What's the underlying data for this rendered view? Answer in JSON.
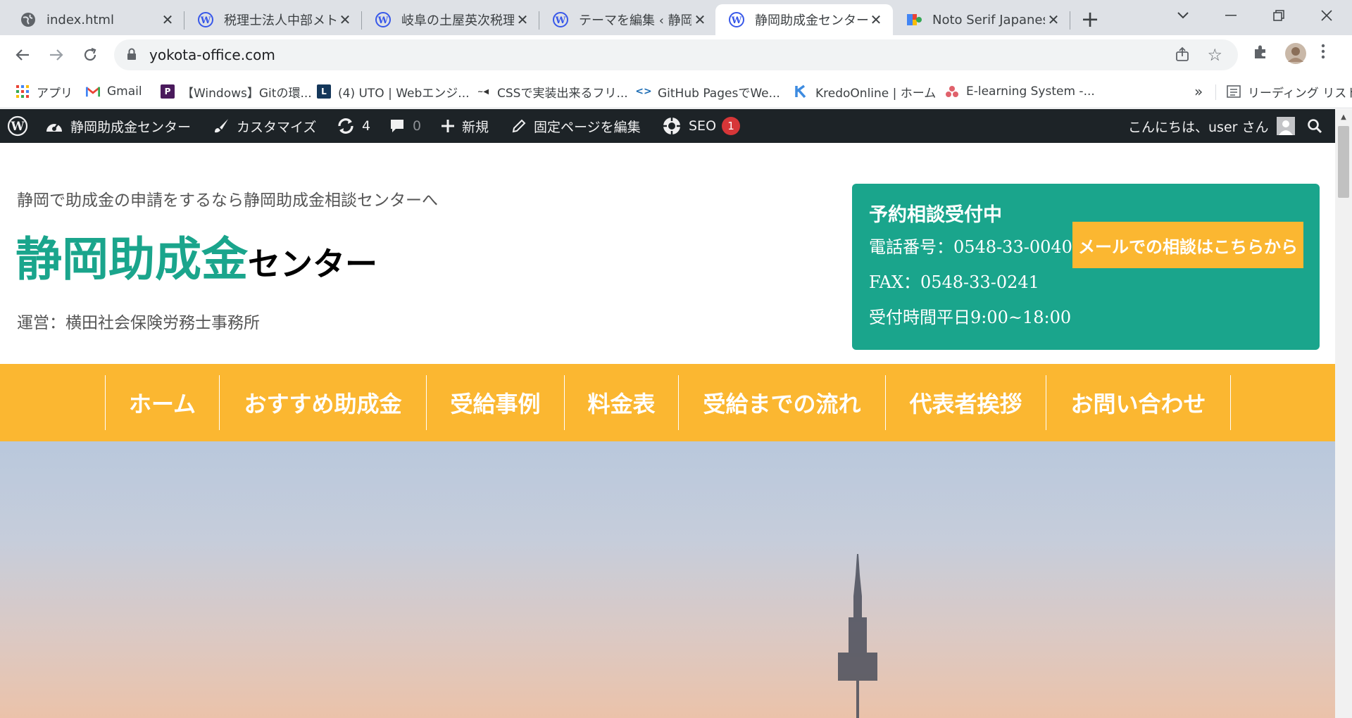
{
  "browser": {
    "tabs": [
      {
        "title": "index.html",
        "icon": "globe-icon"
      },
      {
        "title": "税理士法人中部メト",
        "icon": "wordpress-icon"
      },
      {
        "title": "岐阜の土屋英次税理",
        "icon": "wordpress-icon"
      },
      {
        "title": "テーマを編集 ‹ 静岡助",
        "icon": "wordpress-icon"
      },
      {
        "title": "静岡助成金センター",
        "icon": "wordpress-icon"
      },
      {
        "title": "Noto Serif Japanese",
        "icon": "google-fonts-icon"
      }
    ],
    "active_tab": 4,
    "url": "yokota-office.com"
  },
  "bookmarks": [
    {
      "label": "アプリ",
      "icon": "apps-grid-icon"
    },
    {
      "label": "Gmail",
      "icon": "gmail-icon"
    },
    {
      "label": "【Windows】Gitの環...",
      "icon": "bookmark-p-icon"
    },
    {
      "label": "(4) UTO | Webエンジ...",
      "icon": "bookmark-l-icon"
    },
    {
      "label": "CSSで実装出来るフリ...",
      "icon": "bookmark-css-icon"
    },
    {
      "label": "GitHub PagesでWe...",
      "icon": "code-icon"
    },
    {
      "label": "KredoOnline | ホーム",
      "icon": "kredo-icon"
    },
    {
      "label": "E-learning System -...",
      "icon": "elearning-icon"
    }
  ],
  "bookmarks_overflow": "»",
  "reading_list": "リーディング リスト",
  "admin_bar": {
    "site_name": "静岡助成金センター",
    "customize": "カスタマイズ",
    "updates": "4",
    "comments": "0",
    "new": "新規",
    "edit_page": "固定ページを編集",
    "seo": "SEO",
    "seo_badge": "1",
    "greeting": "こんにちは、user さん"
  },
  "header": {
    "tagline": "静岡で助成金の申請をするなら静岡助成金相談センターへ",
    "title_main": "静岡助成金",
    "title_suffix": "センター",
    "operator": "運営：横田社会保険労務士事務所"
  },
  "contact": {
    "heading": "予約相談受付中",
    "phone": "電話番号：0548-33-0040",
    "fax": "FAX：0548-33-0241",
    "hours": "受付時間平日9:00~18:00",
    "mail_button": "メールでの相談はこちらから"
  },
  "nav": [
    "ホーム",
    "おすすめ助成金",
    "受給事例",
    "料金表",
    "受給までの流れ",
    "代表者挨拶",
    "お問い合わせ"
  ],
  "colors": {
    "accent_green": "#1aa58c",
    "accent_yellow": "#fbb731",
    "admin_bar": "#1d2327",
    "seo_badge": "#d63638"
  }
}
